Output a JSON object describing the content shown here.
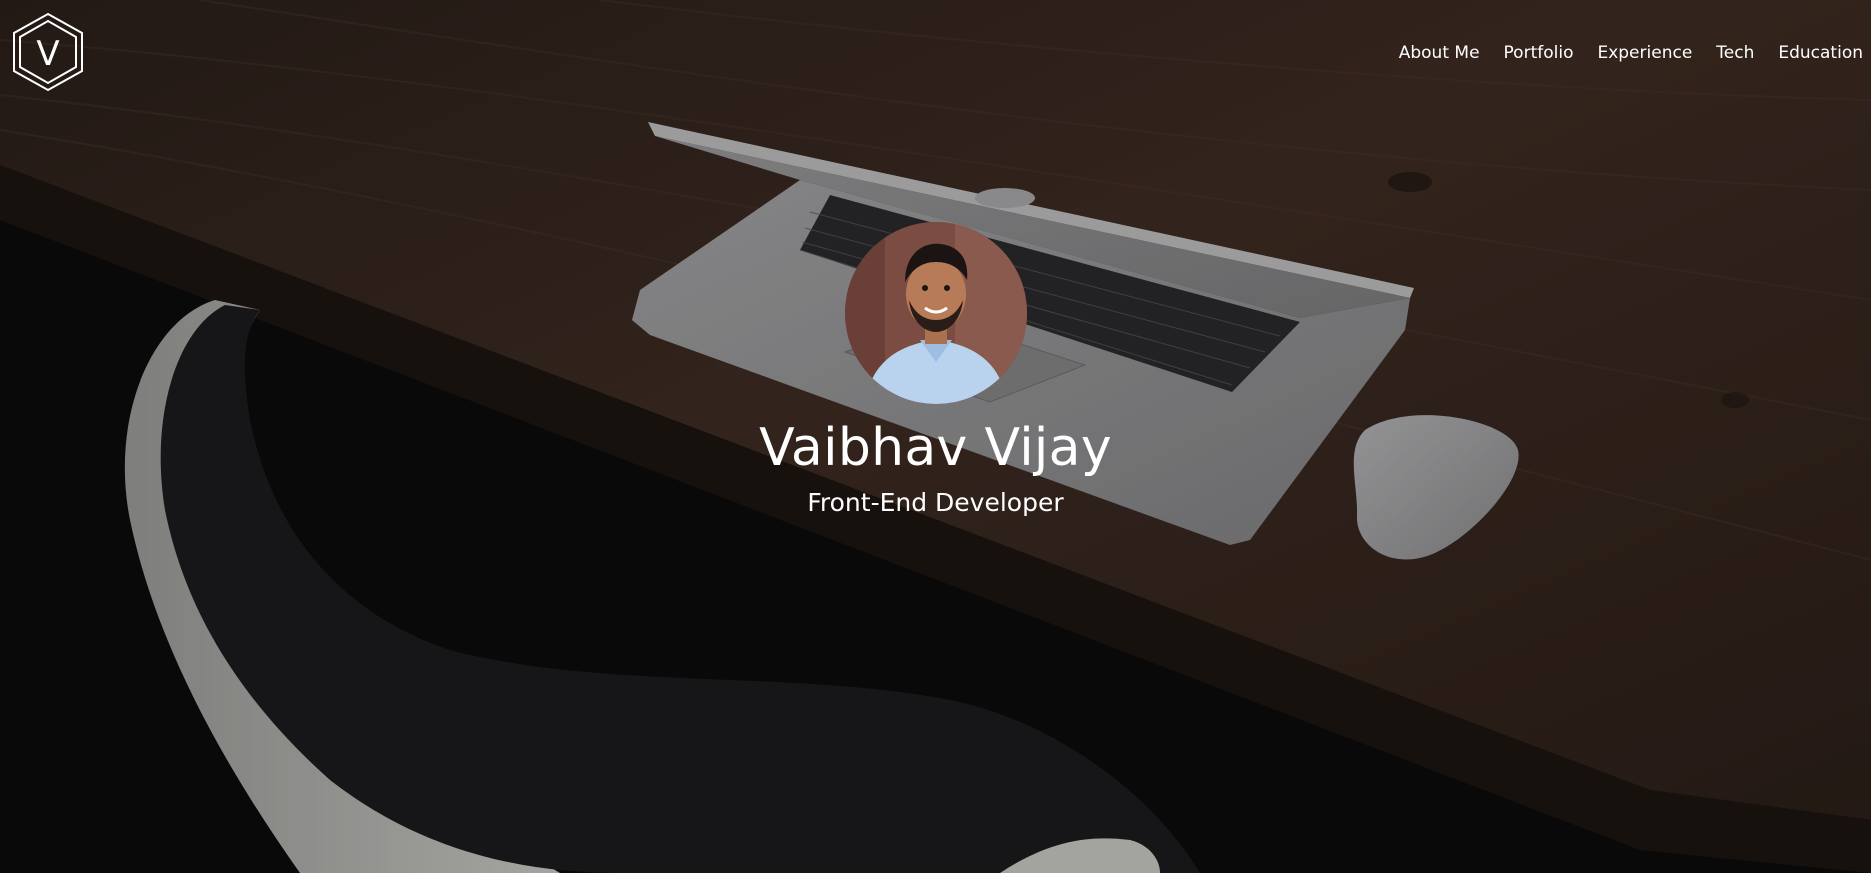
{
  "logo": {
    "letter": "V",
    "icon": "hexagon-v-logo-icon"
  },
  "nav": {
    "items": [
      {
        "label": "About Me"
      },
      {
        "label": "Portfolio"
      },
      {
        "label": "Experience"
      },
      {
        "label": "Tech"
      },
      {
        "label": "Education"
      }
    ]
  },
  "hero": {
    "name": "Vaibhav Vijay",
    "role": "Front-End Developer",
    "avatar_icon": "profile-photo"
  },
  "colors": {
    "text": "#ffffff",
    "desk_wood": "#3a2a22",
    "background_dark": "#0c0c0d",
    "laptop_silver": "#8e8e90"
  }
}
